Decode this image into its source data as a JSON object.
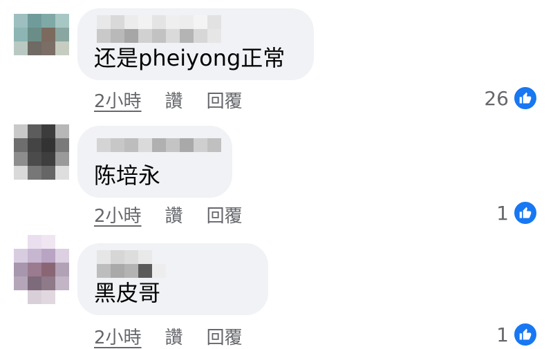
{
  "colors": {
    "bubble": "#f0f2f5",
    "text": "#050505",
    "meta": "#65676b",
    "like_blue": "#1877f2"
  },
  "comments": [
    {
      "text": "还是pheiyong正常",
      "time": "2小時",
      "like_label": "讚",
      "reply_label": "回覆",
      "reaction_count": "26",
      "reaction_icon": "like-icon"
    },
    {
      "text": "陈培永",
      "time": "2小時",
      "like_label": "讚",
      "reply_label": "回覆",
      "reaction_count": "1",
      "reaction_icon": "like-icon"
    },
    {
      "text": "黑皮哥",
      "time": "2小時",
      "like_label": "讚",
      "reply_label": "回覆",
      "reaction_count": "1",
      "reaction_icon": "like-icon"
    }
  ]
}
